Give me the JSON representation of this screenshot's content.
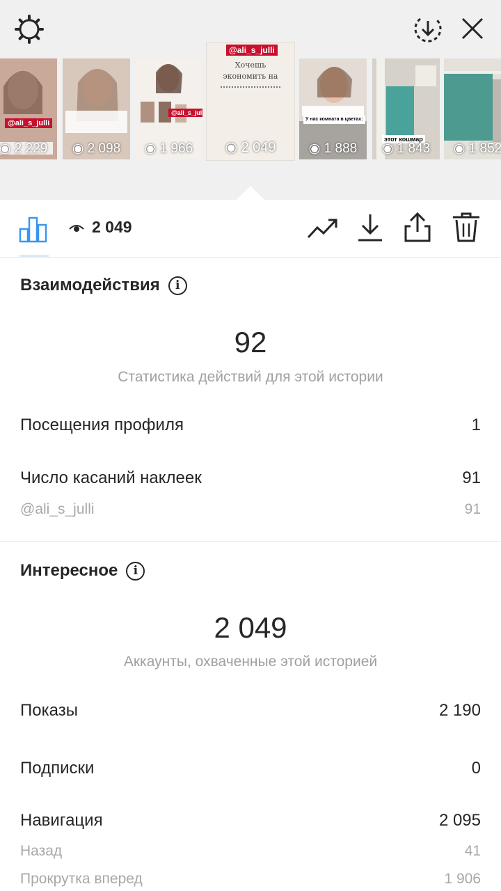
{
  "top": {
    "icons": [
      "gear-icon",
      "download-circle-icon",
      "close-icon"
    ]
  },
  "stories": [
    {
      "views": "2 229",
      "tag": "@ali_s_julli"
    },
    {
      "views": "2 098"
    },
    {
      "views": "1 966",
      "tag": "@ali_s_julli"
    },
    {
      "views": "2 049",
      "tag": "@ali_s_julli",
      "text": "Хочешь экономить на",
      "selected": true
    },
    {
      "views": "1 888",
      "label": "У нас комната в цветах:"
    },
    {
      "views": "1 843",
      "label": "этот кошмар"
    },
    {
      "views": "1 852"
    }
  ],
  "toolbar": {
    "views": "2 049",
    "icons": [
      "bar-chart-icon",
      "eye-icon",
      "trending-icon",
      "download-icon",
      "share-icon",
      "trash-icon"
    ]
  },
  "interactions": {
    "title": "Взаимодействия",
    "total": "92",
    "caption": "Статистика действий для этой истории",
    "rows": [
      {
        "label": "Посещения профиля",
        "value": "1"
      },
      {
        "label": "Число касаний наклеек",
        "value": "91"
      },
      {
        "label": "@ali_s_julli",
        "value": "91",
        "sub": true
      }
    ]
  },
  "discovery": {
    "title": "Интересное",
    "total": "2 049",
    "caption": "Аккаунты, охваченные этой историей",
    "rows": [
      {
        "label": "Показы",
        "value": "2 190"
      },
      {
        "label": "Подписки",
        "value": "0"
      },
      {
        "label": "Навигация",
        "value": "2 095"
      },
      {
        "label": "Назад",
        "value": "41",
        "sub": true
      },
      {
        "label": "Прокрутка вперед",
        "value": "1 906",
        "sub": true
      }
    ]
  },
  "colors": {
    "accent": "#3897f0",
    "muted": "#a0a0a0",
    "text": "#262626",
    "tag": "#c8102e"
  }
}
